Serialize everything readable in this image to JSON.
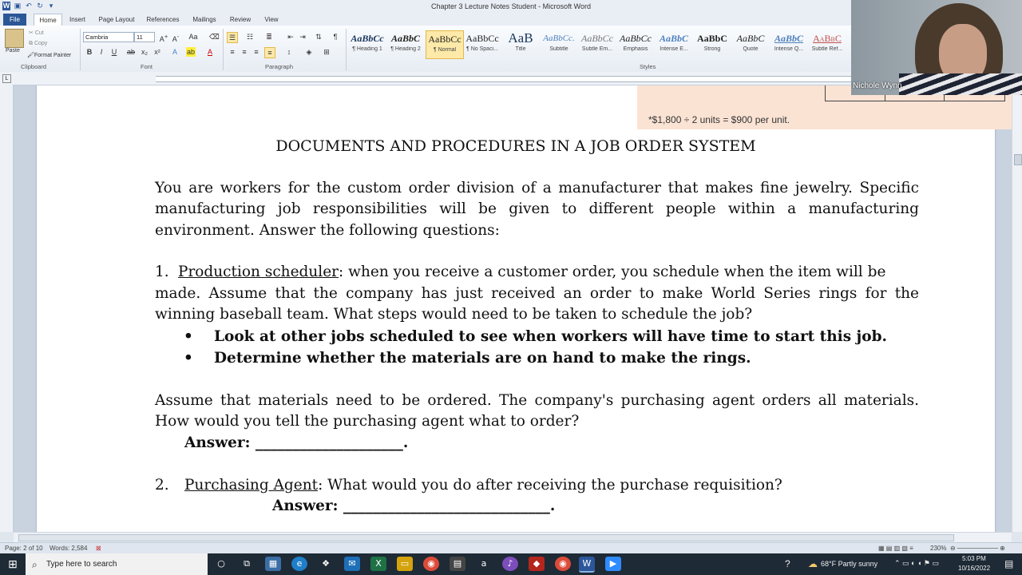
{
  "window": {
    "title": "Chapter 3 Lecture Notes Student - Microsoft Word"
  },
  "tabs": [
    "File",
    "Home",
    "Insert",
    "Page Layout",
    "References",
    "Mailings",
    "Review",
    "View"
  ],
  "ribbon": {
    "clipboard": {
      "paste": "Paste",
      "cut": "Cut",
      "copy": "Copy",
      "format_painter": "Format Painter",
      "label": "Clipboard"
    },
    "font": {
      "name": "Cambria",
      "size": "11",
      "label": "Font"
    },
    "paragraph": {
      "label": "Paragraph"
    },
    "styles": {
      "label": "Styles",
      "items": [
        {
          "sample": "AaBbCc",
          "name": "¶ Heading 1"
        },
        {
          "sample": "AaBbC",
          "name": "¶ Heading 2"
        },
        {
          "sample": "AaBbCc",
          "name": "¶ Normal"
        },
        {
          "sample": "AaBbCc",
          "name": "¶ No Spaci..."
        },
        {
          "sample": "AaB",
          "name": "Title"
        },
        {
          "sample": "AaBbCc.",
          "name": "Subtitle"
        },
        {
          "sample": "AaBbCc",
          "name": "Subtle Em..."
        },
        {
          "sample": "AaBbCc",
          "name": "Emphasis"
        },
        {
          "sample": "AaBbC",
          "name": "Intense E..."
        },
        {
          "sample": "AaBbC",
          "name": "Strong"
        },
        {
          "sample": "AaBbC",
          "name": "Quote"
        },
        {
          "sample": "AaBbC",
          "name": "Intense Q..."
        },
        {
          "sample": "AaBbC",
          "name": "Subtle Ref..."
        }
      ],
      "selected": "¶ Normal"
    }
  },
  "document": {
    "note": "*$1,800 ÷ 2 units = $900 per unit.",
    "heading": "DOCUMENTS AND PROCEDURES IN A JOB ORDER SYSTEM",
    "intro": [
      "You are workers for the custom order division of a manufacturer that makes fine jewelry. Specific",
      "manufacturing job responsibilities will be given to different people within a manufacturing",
      "environment. Answer the following questions:"
    ],
    "q1": {
      "number": "1.",
      "title": "Production scheduler",
      "line1_rest": ": when you receive a customer order, you schedule when the item will be",
      "line2": "made. Assume that the company has just received an order to make World Series rings for the",
      "line3": "winning baseball team. What steps would need to be taken to schedule the job?",
      "bullets": [
        "Look at other jobs scheduled to see when workers will have time to start this job.",
        "Determine whether the materials are on hand to make the rings."
      ]
    },
    "q1b": {
      "line1": "Assume that materials need to be ordered. The company's purchasing agent orders all materials.",
      "line2": "How would you tell the purchasing agent what to order?",
      "answer": "Answer: ____________________."
    },
    "q2": {
      "number": "2.",
      "title": "Purchasing Agent",
      "rest": ":  What would you do after receiving the purchase requisition?",
      "answer": "Answer: ____________________________."
    }
  },
  "status": {
    "page": "Page: 2 of 10",
    "words": "Words: 2,584",
    "zoom": "230%"
  },
  "taskbar": {
    "search_placeholder": "Type here to search",
    "weather": "68°F  Partly sunny",
    "time": "5:03 PM",
    "date": "10/16/2022"
  },
  "webcam": {
    "name": "Nichole Wynn"
  }
}
